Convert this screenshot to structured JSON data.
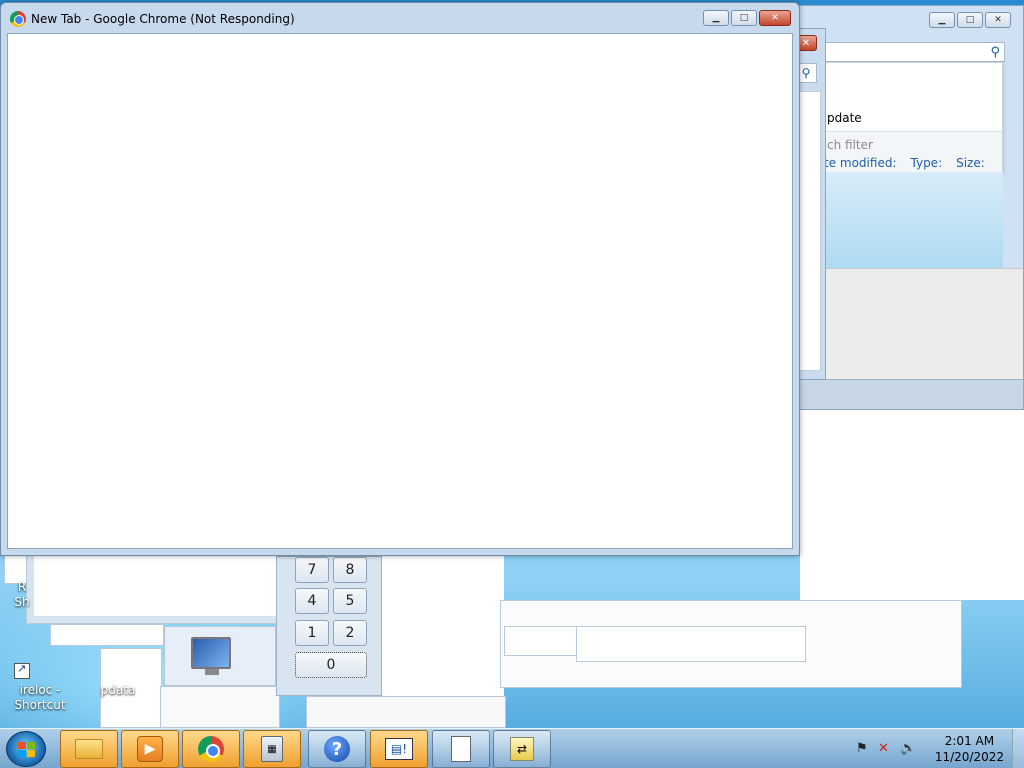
{
  "chrome_window": {
    "title": "New Tab - Google Chrome (Not Responding)"
  },
  "explorer_window": {
    "partial_title": "pdate",
    "filter_text": "ch filter",
    "columns": [
      "te modified:",
      "Type:",
      "Size:"
    ]
  },
  "calculator": {
    "keys": [
      "7",
      "8",
      "4",
      "5",
      "1",
      "2",
      "0"
    ]
  },
  "desktop": {
    "icon_labels": [
      "ireloc -\nShortcut",
      "pdata"
    ],
    "fragment_label": "R\nSh"
  },
  "taskbar": {
    "items": [
      {
        "name": "windows-explorer",
        "icon": "folder-icon",
        "active": true
      },
      {
        "name": "media-center",
        "icon": "media-icon",
        "active": true
      },
      {
        "name": "google-chrome",
        "icon": "chrome-icon",
        "active": true
      },
      {
        "name": "calculator",
        "icon": "calculator-icon",
        "active": true
      },
      {
        "name": "help-and-support",
        "icon": "help-icon",
        "active": false
      },
      {
        "name": "dialog-app",
        "icon": "dialog-icon",
        "active": true
      },
      {
        "name": "blank-document",
        "icon": "document-icon",
        "active": false
      },
      {
        "name": "network-app",
        "icon": "network-icon",
        "active": false
      }
    ],
    "clock": {
      "time": "2:01 AM",
      "date": "11/20/2022"
    }
  },
  "colors": {
    "close_button": "#c5452e",
    "taskbar_active": "#f0a030",
    "link_blue": "#2060a8"
  }
}
